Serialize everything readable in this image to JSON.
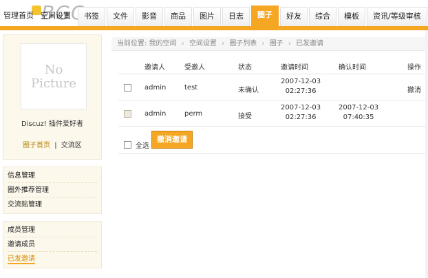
{
  "logo": {
    "text": "BGC",
    "icon": "bgc-logo-icon"
  },
  "nav": {
    "items": [
      "管理首页",
      "空间设置",
      "书签",
      "文件",
      "影音",
      "商品",
      "图片",
      "日志",
      "圈子",
      "好友",
      "综合",
      "模板",
      "资讯/等级审核"
    ],
    "active": "圈子",
    "accent": "#f5a623"
  },
  "profile": {
    "avatar_line1": "No",
    "avatar_line2": "Picture",
    "name": "Discuz! 插件爱好者",
    "link_home": "圈子首页",
    "separator": "|",
    "link_exchange": "交流区"
  },
  "sidebar": {
    "group1": [
      "信息管理",
      "圈外推荐管理",
      "交流贴管理"
    ],
    "group2": [
      "成员管理",
      "邀请成员",
      "已发邀请"
    ],
    "current": "已发邀请"
  },
  "breadcrumb": {
    "prefix": "当前位置:",
    "items": [
      "我的空间",
      "空间设置",
      "圈子列表",
      "圈子",
      "已发邀请"
    ],
    "separator": "›"
  },
  "table": {
    "headers": {
      "inviter": "邀请人",
      "invitee": "受邀人",
      "status": "状态",
      "invite_time": "邀请时间",
      "confirm_time": "确认时间",
      "action": "操作"
    },
    "rows": [
      {
        "inviter": "admin",
        "invitee": "test",
        "status": "未确认",
        "invite_date": "2007-12-03",
        "invite_clock": "02:27:36",
        "confirm_date": "",
        "confirm_clock": "",
        "action": "撤消"
      },
      {
        "inviter": "admin",
        "invitee": "perm",
        "status": "接受",
        "invite_date": "2007-12-03",
        "invite_clock": "02:27:36",
        "confirm_date": "2007-12-03",
        "confirm_clock": "07:40:35",
        "action": ""
      }
    ]
  },
  "footer": {
    "select_all": "全选",
    "cancel_button": "撤消邀请"
  }
}
